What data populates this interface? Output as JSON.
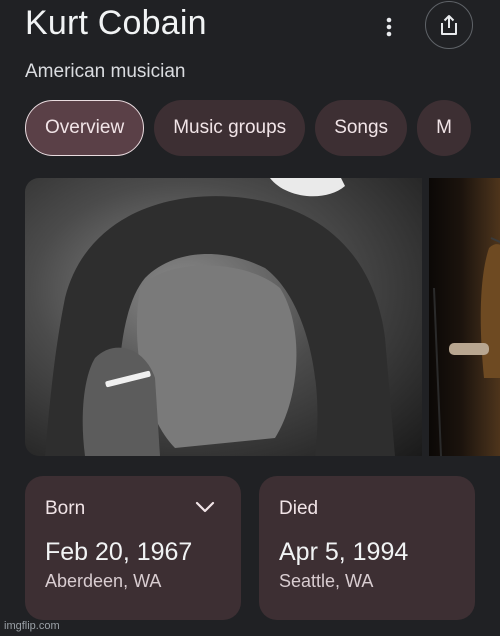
{
  "header": {
    "title": "Kurt Cobain",
    "subtitle": "American musician",
    "more_icon": "more-vert-icon",
    "share_icon": "share-icon"
  },
  "tabs": [
    {
      "label": "Overview",
      "active": true
    },
    {
      "label": "Music groups",
      "active": false
    },
    {
      "label": "Songs",
      "active": false
    },
    {
      "label": "M",
      "active": false
    }
  ],
  "gallery": {
    "images": [
      "portrait-photo",
      "concert-photo"
    ]
  },
  "facts": {
    "born": {
      "label": "Born",
      "date": "Feb 20, 1967",
      "place": "Aberdeen, WA",
      "expand_icon": "chevron-down-icon"
    },
    "died": {
      "label": "Died",
      "date": "Apr 5, 1994",
      "place": "Seattle, WA"
    }
  },
  "watermark": "imgflip.com",
  "colors": {
    "background": "#202124",
    "chip": "#3d2f33",
    "chip_active": "#5a4047"
  }
}
